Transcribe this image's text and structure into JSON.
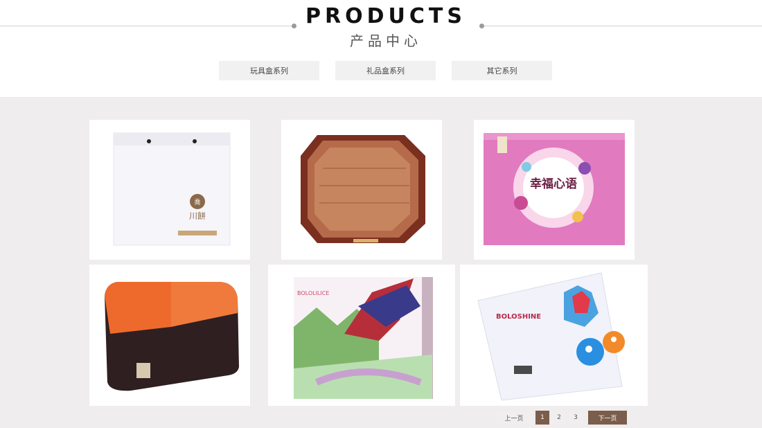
{
  "header": {
    "title_en": "PRODUCTS",
    "title_cn": "产品中心"
  },
  "tabs": [
    {
      "label": "玩具盒系列"
    },
    {
      "label": "礼品盒系列"
    },
    {
      "label": "其它系列"
    }
  ],
  "products": [
    {
      "name": "white-shopping-bag-image",
      "caption": "川餅"
    },
    {
      "name": "wooden-octagonal-box-image"
    },
    {
      "name": "pink-gift-box-image",
      "caption": "幸福心语"
    },
    {
      "name": "orange-black-box-image"
    },
    {
      "name": "bololilice-jigsaw-box-image",
      "caption": "BOLOLILICE"
    },
    {
      "name": "boloshine-card-box-image",
      "caption": "BOLOSHINE"
    }
  ],
  "pagination": {
    "prev": "上一页",
    "pages": [
      "1",
      "2",
      "3"
    ],
    "current": "1",
    "next": "下一页"
  },
  "colors": {
    "accent": "#7a5d4b",
    "gallery_bg": "#efeded",
    "tab_bg": "#f1f1f1"
  }
}
